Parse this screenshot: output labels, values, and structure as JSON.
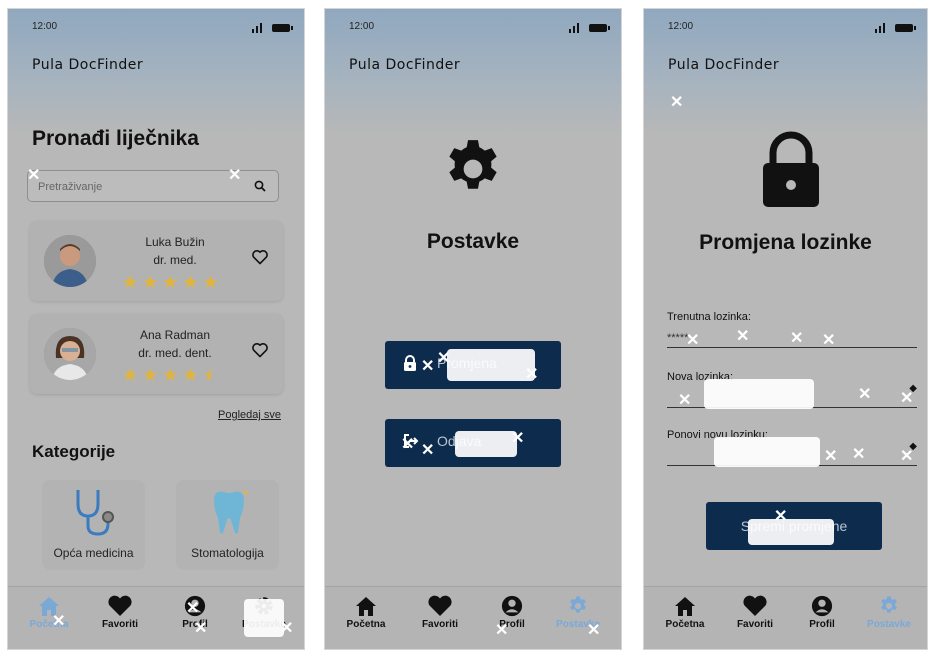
{
  "status_bar": {
    "time": "12:00"
  },
  "app_name": "Pula DocFinder",
  "screen_home": {
    "title": "Pronađi liječnika",
    "search_placeholder": "Pretraživanje",
    "doctors": [
      {
        "name": "Luka Bužin",
        "title": "dr. med.",
        "rating": 5
      },
      {
        "name": "Ana Radman",
        "title": "dr. med. dent.",
        "rating": 4.5
      }
    ],
    "view_all": "Pogledaj sve",
    "categories_title": "Kategorije",
    "categories": [
      {
        "label": "Opća medicina",
        "icon": "stethoscope-icon"
      },
      {
        "label": "Stomatologija",
        "icon": "tooth-icon"
      }
    ]
  },
  "screen_settings": {
    "title": "Postavke",
    "button_password": "Promjena",
    "button_logout": "Odjava"
  },
  "screen_password": {
    "title": "Promjena lozinke",
    "current_label": "Trenutna lozinka:",
    "current_value": "*****",
    "new_label": "Nova lozinka:",
    "repeat_label": "Ponovi novu lozinku:",
    "submit": "Spremi promjene"
  },
  "nav": {
    "home": "Početna",
    "favorites": "Favoriti",
    "profile": "Profil",
    "settings": "Postavke"
  },
  "colors": {
    "primary": "#0d2b4c",
    "active_nav": "#7aa9d8",
    "star": "#e2b53a"
  }
}
